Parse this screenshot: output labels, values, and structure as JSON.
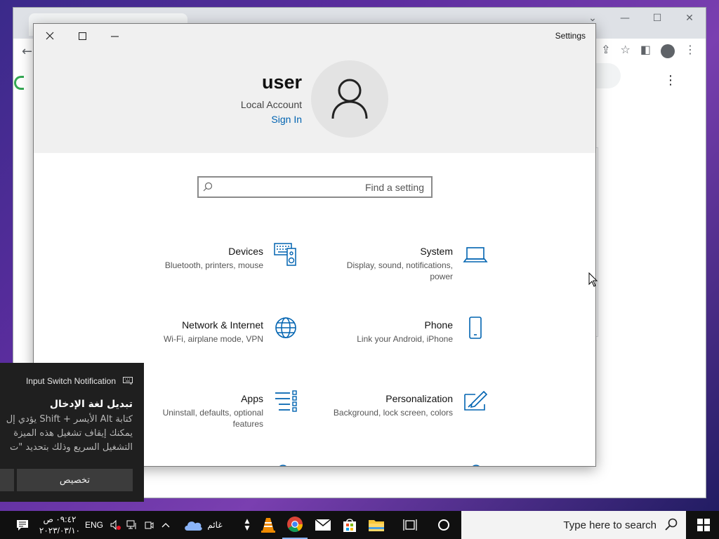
{
  "settings": {
    "app_title": "Settings",
    "user": {
      "name": "user",
      "account_type": "Local Account",
      "sign_in": "Sign In"
    },
    "search": {
      "placeholder": "Find a setting"
    },
    "tiles": [
      {
        "title": "Devices",
        "desc": "Bluetooth, printers, mouse",
        "icon": "devices-icon"
      },
      {
        "title": "System",
        "desc": "Display, sound, notifications, power",
        "icon": "laptop-icon"
      },
      {
        "title": "Network & Internet",
        "desc": "Wi-Fi, airplane mode, VPN",
        "icon": "globe-icon"
      },
      {
        "title": "Phone",
        "desc": "Link your Android, iPhone",
        "icon": "phone-icon"
      },
      {
        "title": "Apps",
        "desc": "Uninstall, defaults, optional features",
        "icon": "apps-icon"
      },
      {
        "title": "Personalization",
        "desc": "Background, lock screen, colors",
        "icon": "personalization-icon"
      }
    ]
  },
  "notification": {
    "title": "Input Switch Notification",
    "heading": "تبديل لغة الإدخال",
    "lines": [
      "كتابة Alt الأيسر + Shift يؤدي إل",
      "يمكنك إيقاف تشغيل هذه الميزة",
      "التشغيل السريع وذلك بتحديد \"ت"
    ],
    "button": "تخصيص"
  },
  "taskbar": {
    "time": "٠٩:٤٢ ص",
    "date": "٢٠٢٣/٠٣/١٠",
    "language": "ENG",
    "weather": "غائم",
    "search_placeholder": "Type here to search"
  },
  "colors": {
    "accent": "#0063b1",
    "taskbar": "#101010"
  }
}
